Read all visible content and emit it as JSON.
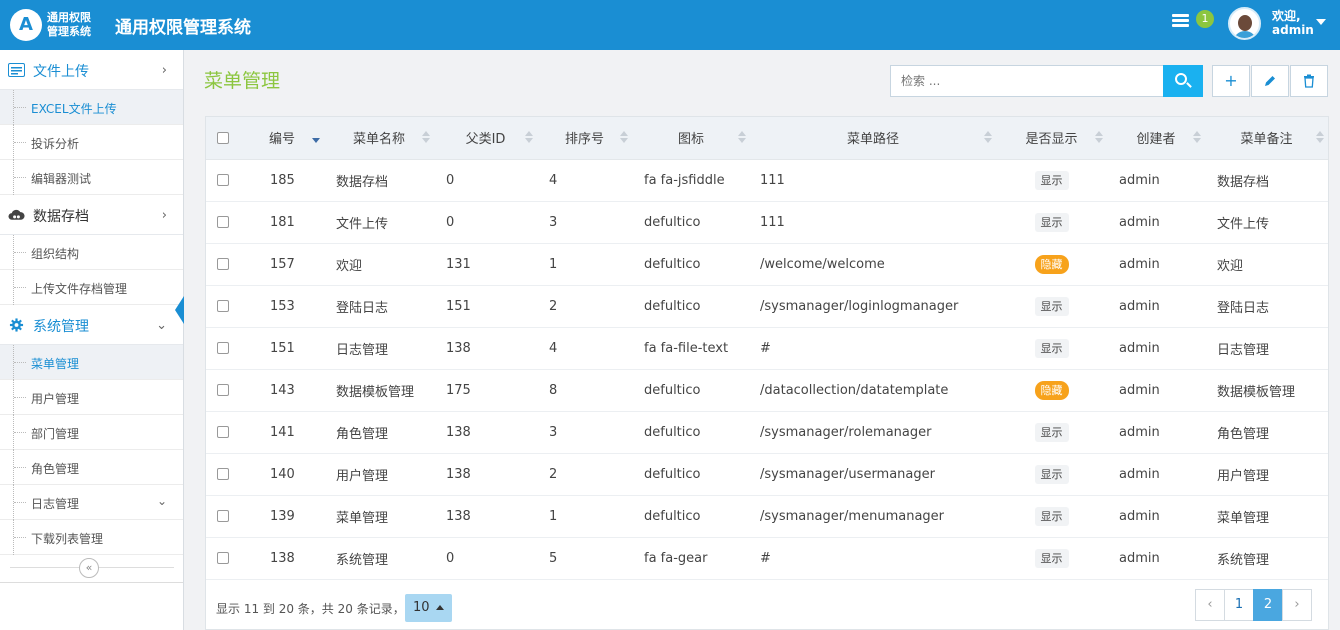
{
  "header": {
    "logo_text_line1": "通用权限",
    "logo_text_line2": "管理系统",
    "app_title": "通用权限管理系统",
    "notification_count": "1",
    "welcome_line1": "欢迎,",
    "welcome_line2": "admin",
    "brand_color": "#1a8ed3"
  },
  "sidebar": {
    "groups": [
      {
        "label": "文件上传",
        "icon": "upload-card-icon",
        "items": [
          "EXCEL文件上传",
          "投诉分析",
          "编辑器测试"
        ]
      },
      {
        "label": "数据存档",
        "icon": "cloud-icon",
        "items": [
          "组织结构",
          "上传文件存档管理"
        ]
      },
      {
        "label": "系统管理",
        "icon": "gear-icon",
        "items": [
          "菜单管理",
          "用户管理",
          "部门管理",
          "角色管理",
          "日志管理",
          "下载列表管理"
        ]
      }
    ],
    "current_item": "菜单管理"
  },
  "main": {
    "page_title": "菜单管理",
    "search_placeholder": "检索 ...",
    "toolbar": {
      "add": "+",
      "edit": "edit",
      "delete": "delete"
    },
    "columns": [
      "编号",
      "菜单名称",
      "父类ID",
      "排序号",
      "图标",
      "菜单路径",
      "是否显示",
      "创建者",
      "菜单备注"
    ],
    "rows": [
      {
        "id": "185",
        "name": "数据存档",
        "parent": "0",
        "order": "4",
        "icon": "fa fa-jsfiddle",
        "path": "111",
        "visible": "显示",
        "hidden": false,
        "creator": "admin",
        "note": "数据存档"
      },
      {
        "id": "181",
        "name": "文件上传",
        "parent": "0",
        "order": "3",
        "icon": "defultico",
        "path": "111",
        "visible": "显示",
        "hidden": false,
        "creator": "admin",
        "note": "文件上传"
      },
      {
        "id": "157",
        "name": "欢迎",
        "parent": "131",
        "order": "1",
        "icon": "defultico",
        "path": "/welcome/welcome",
        "visible": "隐藏",
        "hidden": true,
        "creator": "admin",
        "note": "欢迎"
      },
      {
        "id": "153",
        "name": "登陆日志",
        "parent": "151",
        "order": "2",
        "icon": "defultico",
        "path": "/sysmanager/loginlogmanager",
        "visible": "显示",
        "hidden": false,
        "creator": "admin",
        "note": "登陆日志"
      },
      {
        "id": "151",
        "name": "日志管理",
        "parent": "138",
        "order": "4",
        "icon": "fa fa-file-text",
        "path": "#",
        "visible": "显示",
        "hidden": false,
        "creator": "admin",
        "note": "日志管理"
      },
      {
        "id": "143",
        "name": "数据模板管理",
        "parent": "175",
        "order": "8",
        "icon": "defultico",
        "path": "/datacollection/datatemplate",
        "visible": "隐藏",
        "hidden": true,
        "creator": "admin",
        "note": "数据模板管理"
      },
      {
        "id": "141",
        "name": "角色管理",
        "parent": "138",
        "order": "3",
        "icon": "defultico",
        "path": "/sysmanager/rolemanager",
        "visible": "显示",
        "hidden": false,
        "creator": "admin",
        "note": "角色管理"
      },
      {
        "id": "140",
        "name": "用户管理",
        "parent": "138",
        "order": "2",
        "icon": "defultico",
        "path": "/sysmanager/usermanager",
        "visible": "显示",
        "hidden": false,
        "creator": "admin",
        "note": "用户管理"
      },
      {
        "id": "139",
        "name": "菜单管理",
        "parent": "138",
        "order": "1",
        "icon": "defultico",
        "path": "/sysmanager/menumanager",
        "visible": "显示",
        "hidden": false,
        "creator": "admin",
        "note": "菜单管理"
      },
      {
        "id": "138",
        "name": "系统管理",
        "parent": "0",
        "order": "5",
        "icon": "fa fa-gear",
        "path": "#",
        "visible": "显示",
        "hidden": false,
        "creator": "admin",
        "note": "系统管理"
      }
    ],
    "footer_info": "显示 11 到 20 条，共 20 条记录，",
    "page_size": "10",
    "pager": {
      "prev": "‹",
      "pages": [
        "1",
        "2"
      ],
      "active": "2",
      "next": "›"
    }
  }
}
